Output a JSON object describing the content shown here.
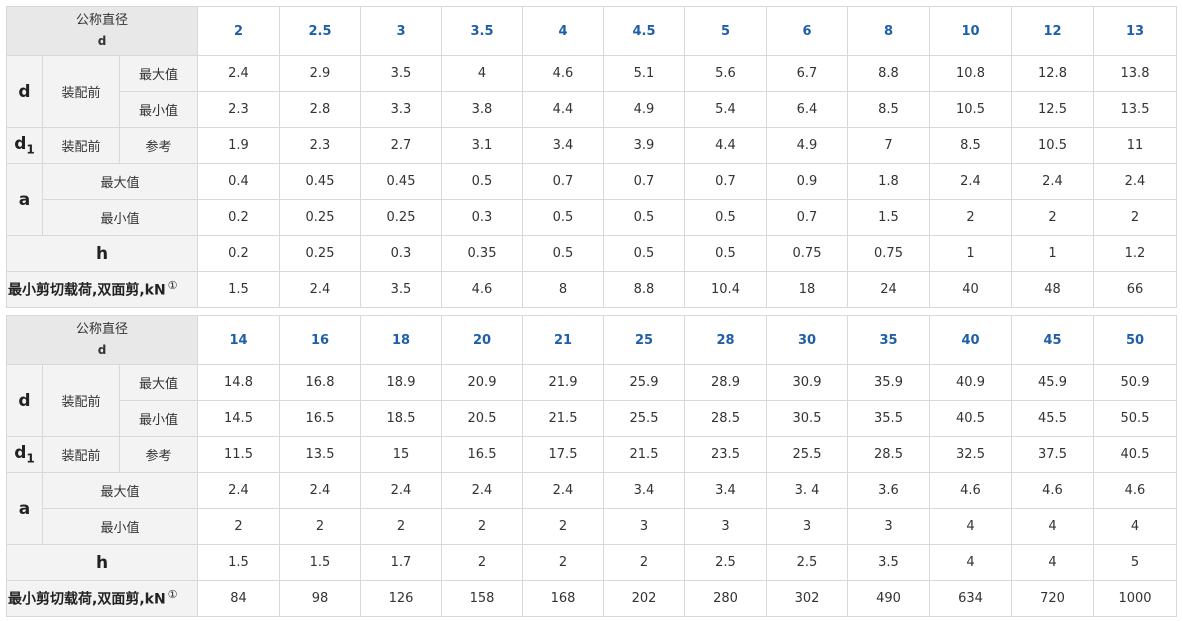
{
  "labels": {
    "nominal_diameter": "公称直径",
    "d": "d",
    "d1_base": "d",
    "d1_sub": "1",
    "a": "a",
    "h": "h",
    "before_assembly": "装配前",
    "max": "最大值",
    "min": "最小值",
    "reference": "参考",
    "shear_load": "最小剪切载荷,双面剪,kN",
    "note_mark": "①"
  },
  "tables": [
    {
      "sizes": [
        "2",
        "2.5",
        "3",
        "3.5",
        "4",
        "4.5",
        "5",
        "6",
        "8",
        "10",
        "12",
        "13"
      ],
      "d_max": [
        "2.4",
        "2.9",
        "3.5",
        "4",
        "4.6",
        "5.1",
        "5.6",
        "6.7",
        "8.8",
        "10.8",
        "12.8",
        "13.8"
      ],
      "d_min": [
        "2.3",
        "2.8",
        "3.3",
        "3.8",
        "4.4",
        "4.9",
        "5.4",
        "6.4",
        "8.5",
        "10.5",
        "12.5",
        "13.5"
      ],
      "d1_ref": [
        "1.9",
        "2.3",
        "2.7",
        "3.1",
        "3.4",
        "3.9",
        "4.4",
        "4.9",
        "7",
        "8.5",
        "10.5",
        "11"
      ],
      "a_max": [
        "0.4",
        "0.45",
        "0.45",
        "0.5",
        "0.7",
        "0.7",
        "0.7",
        "0.9",
        "1.8",
        "2.4",
        "2.4",
        "2.4"
      ],
      "a_min": [
        "0.2",
        "0.25",
        "0.25",
        "0.3",
        "0.5",
        "0.5",
        "0.5",
        "0.7",
        "1.5",
        "2",
        "2",
        "2"
      ],
      "h": [
        "0.2",
        "0.25",
        "0.3",
        "0.35",
        "0.5",
        "0.5",
        "0.5",
        "0.75",
        "0.75",
        "1",
        "1",
        "1.2"
      ],
      "shear": [
        "1.5",
        "2.4",
        "3.5",
        "4.6",
        "8",
        "8.8",
        "10.4",
        "18",
        "24",
        "40",
        "48",
        "66"
      ]
    },
    {
      "sizes": [
        "14",
        "16",
        "18",
        "20",
        "21",
        "25",
        "28",
        "30",
        "35",
        "40",
        "45",
        "50"
      ],
      "d_max": [
        "14.8",
        "16.8",
        "18.9",
        "20.9",
        "21.9",
        "25.9",
        "28.9",
        "30.9",
        "35.9",
        "40.9",
        "45.9",
        "50.9"
      ],
      "d_min": [
        "14.5",
        "16.5",
        "18.5",
        "20.5",
        "21.5",
        "25.5",
        "28.5",
        "30.5",
        "35.5",
        "40.5",
        "45.5",
        "50.5"
      ],
      "d1_ref": [
        "11.5",
        "13.5",
        "15",
        "16.5",
        "17.5",
        "21.5",
        "23.5",
        "25.5",
        "28.5",
        "32.5",
        "37.5",
        "40.5"
      ],
      "a_max": [
        "2.4",
        "2.4",
        "2.4",
        "2.4",
        "2.4",
        "3.4",
        "3.4",
        "3. 4",
        "3.6",
        "4.6",
        "4.6",
        "4.6"
      ],
      "a_min": [
        "2",
        "2",
        "2",
        "2",
        "2",
        "3",
        "3",
        "3",
        "3",
        "4",
        "4",
        "4"
      ],
      "h": [
        "1.5",
        "1.5",
        "1.7",
        "2",
        "2",
        "2",
        "2.5",
        "2.5",
        "3.5",
        "4",
        "4",
        "5"
      ],
      "shear": [
        "84",
        "98",
        "126",
        "158",
        "168",
        "202",
        "280",
        "302",
        "490",
        "634",
        "720",
        "1000"
      ]
    }
  ]
}
